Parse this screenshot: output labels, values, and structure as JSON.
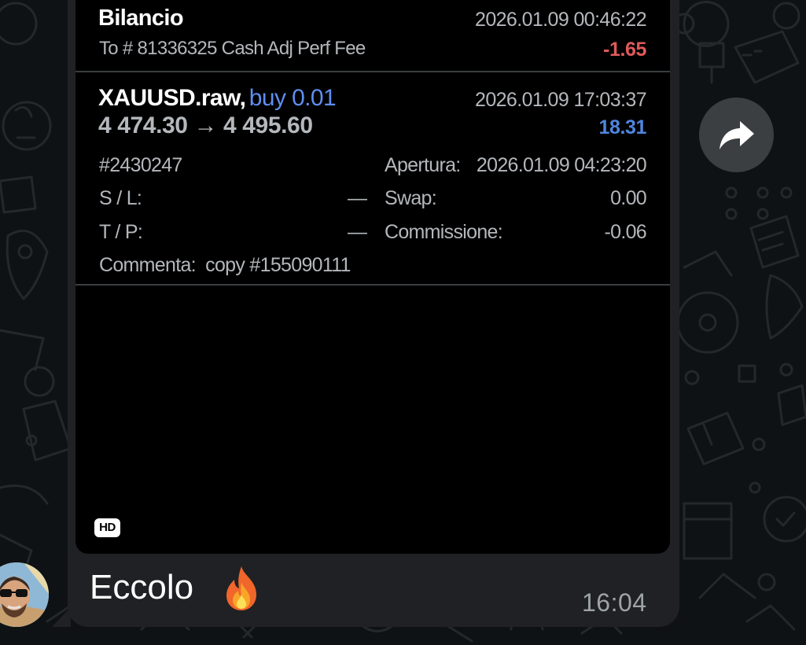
{
  "statement": {
    "balance": {
      "title": "Bilancio",
      "datetime": "2026.01.09 00:46:22",
      "description": "To # 81336325 Cash Adj Perf Fee",
      "amount": "-1.65"
    },
    "trade": {
      "symbol": "XAUUSD.raw,",
      "side": "buy 0.01",
      "datetime": "2026.01.09 17:03:37",
      "price_range": "4 474.30 → 4 495.60",
      "profit": "18.31",
      "ticket": "#2430247",
      "open_label": "Apertura:",
      "open_datetime": "2026.01.09 04:23:20",
      "sl_label": "S / L:",
      "sl_value": "—",
      "swap_label": "Swap:",
      "swap_value": "0.00",
      "tp_label": "T / P:",
      "tp_value": "—",
      "commission_label": "Commissione:",
      "commission_value": "-0.06",
      "comment_label": "Commenta:",
      "comment_value": "copy #155090111"
    }
  },
  "media": {
    "quality_badge": "HD"
  },
  "message": {
    "caption": "Eccolo",
    "emoji": "fire",
    "time": "16:04"
  },
  "actions": {
    "forward_icon": "share-forward-icon"
  },
  "colors": {
    "negative": "#e05a5a",
    "positive": "#4f86e0",
    "buy": "#5f8ef0",
    "bubble": "#1f2124"
  }
}
